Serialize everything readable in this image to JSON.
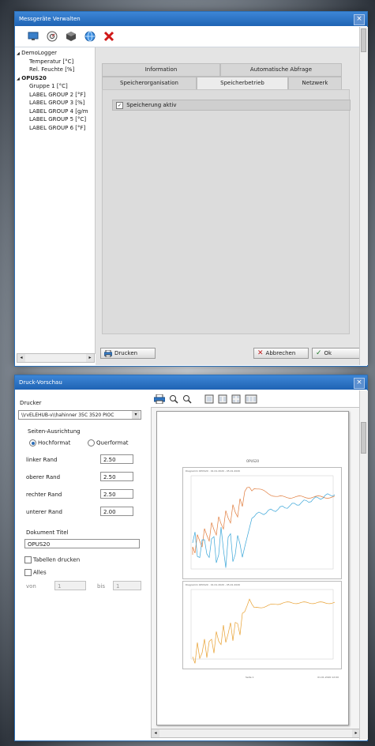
{
  "window1": {
    "title": "Messgeräte Verwalten",
    "close_glyph": "×",
    "toolbar_icons": [
      "monitor-icon",
      "settings-dial-icon",
      "cube-icon",
      "globe-icon",
      "delete-x-icon"
    ],
    "tree": [
      {
        "label": "DemoLogger",
        "level": 0,
        "bold": false,
        "expander": "◢"
      },
      {
        "label": "Temperatur [°C]",
        "level": 1
      },
      {
        "label": "Rel. Feuchte [%]",
        "level": 1
      },
      {
        "label": "OPUS20",
        "level": 0,
        "bold": true,
        "expander": "◢"
      },
      {
        "label": "Gruppe 1 [°C]",
        "level": 1
      },
      {
        "label": "LABEL GROUP 2 [°F]",
        "level": 1
      },
      {
        "label": "LABEL GROUP 3 [%]",
        "level": 1
      },
      {
        "label": "LABEL GROUP 4 [g/m",
        "level": 1
      },
      {
        "label": "LABEL GROUP 5 [°C]",
        "level": 1
      },
      {
        "label": "LABEL GROUP 6 [°F]",
        "level": 1
      }
    ],
    "tabs_row1": [
      "Information",
      "Automatische Abfrage"
    ],
    "tabs_row2": [
      "Speicherorganisation",
      "Speicherbetrieb",
      "Netzwerk"
    ],
    "active_tab": "Speicherbetrieb",
    "checkbox_label": "Speicherung aktiv",
    "checkbox_glyph": "✓",
    "print_button": "Drucken",
    "cancel_button": "Abbrechen",
    "ok_button": "Ok",
    "scroll_left": "◂",
    "scroll_right": "▸"
  },
  "window2": {
    "title": "Druck-Vorschau",
    "close_glyph": "×",
    "printer_label": "Drucker",
    "printer_value": "\\\\rvELEHUB-v\\\\hahinner 35C 3520 PIOC",
    "select_arrow": "▾",
    "orientation_label": "Seiten-Ausrichtung",
    "portrait_label": "Hochformat",
    "landscape_label": "Querformat",
    "margins": [
      {
        "label": "linker Rand",
        "value": "2.50"
      },
      {
        "label": "oberer Rand",
        "value": "2.50"
      },
      {
        "label": "rechter Rand",
        "value": "2.50"
      },
      {
        "label": "unterer Rand",
        "value": "2.00"
      }
    ],
    "doc_title_label": "Dokument Titel",
    "doc_title_value": "OPUS20",
    "print_table_label": "Tabellen drucken",
    "all_label": "Alles",
    "from_label": "von",
    "from_value": "1",
    "to_label": "bis",
    "to_value": "1",
    "toolbar_icons": [
      "printer-icon",
      "zoom-in-icon",
      "zoom-out-icon",
      "one-page-icon",
      "two-page-icon",
      "four-page-icon",
      "multi-page-icon"
    ],
    "page_heading": "OPUS20",
    "page_footer_left": "Seite 1",
    "page_footer_right": "01.01.2020 12:00",
    "chart1_title": "Diagramm OPUS20 · 01.01.2020 - 05.01.2020",
    "chart2_title": "Diagramm OPUS20 · 01.01.2020 - 05.01.2020",
    "series_colors": {
      "temperature": "#e07a3a",
      "humidity": "#3aa6d8",
      "group": "#e8a030"
    }
  }
}
